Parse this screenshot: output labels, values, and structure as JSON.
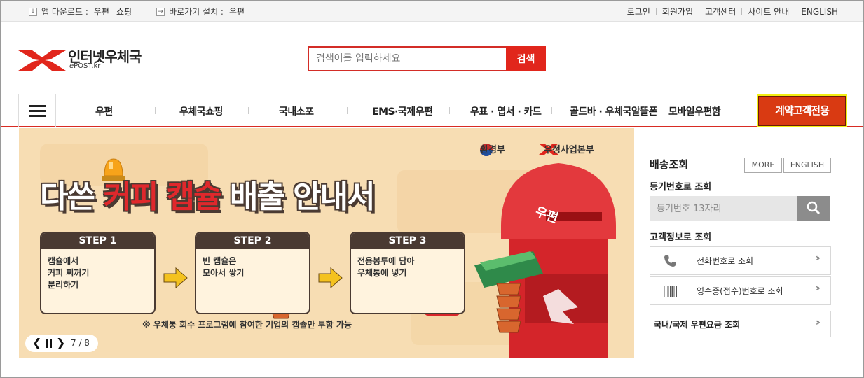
{
  "topbar": {
    "app_download_label": "앱 다운로드 :",
    "app_links": [
      "우편",
      "쇼핑"
    ],
    "shortcut_label": "바로가기 설치 :",
    "shortcut_link": "우편",
    "right_links": [
      "로그인",
      "회원가입",
      "고객센터",
      "사이트 안내",
      "ENGLISH"
    ]
  },
  "logo": {
    "title": "인터넷우체국",
    "subtitle_e": "e",
    "subtitle_rest": "POST.kr"
  },
  "search": {
    "placeholder": "검색어를 입력하세요",
    "button": "검색"
  },
  "nav": {
    "items": [
      "우편",
      "우체국쇼핑",
      "국내소포",
      "EMS·국제우편",
      "우표 · 엽서 · 카드",
      "골드바 · 우체국알뜰폰",
      "모바일우편함"
    ],
    "contract_button": "계약고객전용"
  },
  "banner": {
    "partner1": "환경부",
    "partner2": "우정사업본부",
    "headline_part1": "다쓴 ",
    "headline_part2": "커피 캡슐",
    "headline_part3": " 배출 안내서",
    "steps": [
      {
        "title": "STEP 1",
        "lines": [
          "캡슐에서",
          "커피 찌꺼기",
          "분리하기"
        ]
      },
      {
        "title": "STEP 2",
        "lines": [
          "빈 캡슐은",
          "모아서 쌓기"
        ]
      },
      {
        "title": "STEP 3",
        "lines": [
          "전용봉투에 담아",
          "우체통에 넣기"
        ]
      }
    ],
    "notice": "※ 우체통 회수 프로그램에 참여한 기업의 캡슐만 투함 가능",
    "counter": "7 / 8",
    "mailbox_text": "우편"
  },
  "tracking": {
    "title": "배송조회",
    "more_button": "MORE",
    "english_button": "ENGLISH",
    "by_number_label": "등기번호로 조회",
    "input_placeholder": "등기번호 13자리",
    "by_customer_label": "고객정보로 조회",
    "phone_lookup": "전화번호로 조회",
    "receipt_lookup": "영수증(접수)번호로 조회",
    "rate_lookup": "국내/국제 우편요금 조회"
  },
  "colors": {
    "brand_red": "#e1261c",
    "contract_bg": "#d93a12",
    "contract_border": "#f2ee13"
  }
}
